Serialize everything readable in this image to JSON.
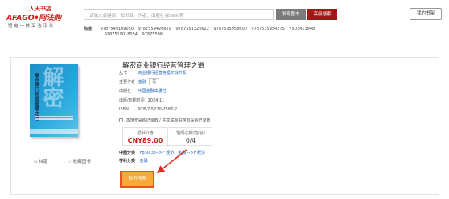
{
  "header": {
    "logo_top": "人天书店",
    "logo_brand_left": "AFAGO",
    "logo_brand_dot": "•",
    "logo_brand_right": "阿法购",
    "logo_sub": "馆 电 一 体 采 选 平 台",
    "search_placeholder": "请输入关键词，如书名、作者、出版社或ISBN等",
    "search_button": "发现图书",
    "advanced_button": "高级搜索",
    "shelf_button": "我的书架",
    "hot_label": "热搜：",
    "hot_keywords": [
      "9787549109050",
      "9787559426659",
      "9787551325622",
      "9787535958600",
      "9787535954275",
      "7503413948",
      "9787519018054",
      "97875596..."
    ]
  },
  "book": {
    "title": "解密商业银行经营管理之道",
    "cover": {
      "big_text": "解密",
      "title": "商业银行经营管理之道"
    },
    "meta": [
      {
        "key": "丛书",
        "value": "商业银行经营管理实战书系",
        "style": "link"
      },
      {
        "key": "主要作者",
        "value": "金融",
        "tag": "著"
      },
      {
        "key": "出版社",
        "value": "中国金融出版社",
        "style": "link"
      },
      {
        "key": "出版/印刷时间",
        "value": "2024.11",
        "style": "plain"
      },
      {
        "key": "ISBN",
        "value": "978-7-5220-2587-2",
        "style": "plain"
      }
    ],
    "stock_note": "本馆无采购记录数 / 共享联图书馆有采购记录数",
    "price_label": "纸书价格",
    "price_value": "CNY89.00",
    "borrow_label": "借阅次数(借/总)",
    "borrow_value": "0/4",
    "classification": [
      {
        "key": "中图分类",
        "value": "F830.33-->F 经济、金融 -->F 经济"
      },
      {
        "key": "学科分类",
        "value": "金融"
      }
    ],
    "actions": {
      "share": "纠错",
      "favorite": "收藏图书"
    },
    "borrow_button": "借书预购"
  },
  "colors": {
    "brand_red": "#c8201b",
    "link_blue": "#1d5fb5",
    "button_orange": "#f7a93a",
    "highlight_red": "#e8541d"
  }
}
